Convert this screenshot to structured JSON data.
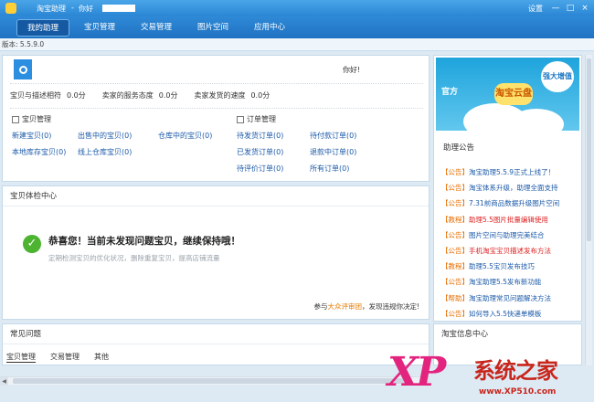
{
  "titlebar": {
    "app_title": "淘宝助理",
    "separator": "-",
    "user_label": "你好",
    "settings_label": "设置",
    "minimize": "—",
    "maximize": "□",
    "close": "×"
  },
  "nav": {
    "tabs": [
      {
        "label": "我的助理",
        "active": true
      },
      {
        "label": "宝贝管理",
        "active": false
      },
      {
        "label": "交易管理",
        "active": false
      },
      {
        "label": "图片空间",
        "active": false
      },
      {
        "label": "应用中心",
        "active": false
      }
    ]
  },
  "version": "版本: 5.5.9.0",
  "profile": {
    "username": "你好!",
    "ratings": [
      {
        "label": "宝贝与描述相符",
        "value": "0.0分"
      },
      {
        "label": "卖家的服务态度",
        "value": "0.0分"
      },
      {
        "label": "卖家发货的速度",
        "value": "0.0分"
      }
    ],
    "item_section": {
      "title": "宝贝管理",
      "links": [
        "出售中的宝贝(0)",
        "仓库中的宝贝(0)",
        "线上仓库宝贝(0)",
        "本地库存宝贝(0)",
        "新建宝贝(0)"
      ]
    },
    "order_section": {
      "title": "订单管理",
      "links": [
        "待发货订单(0)",
        "待付款订单(0)",
        "已发货订单(0)",
        "退款中订单(0)",
        "待评价订单(0)",
        "所有订单(0)"
      ]
    }
  },
  "health": {
    "title": "宝贝体检中心",
    "headline": "恭喜您！当前未发现问题宝贝，继续保持哦！",
    "subtext": "定期检测宝贝的优化状况，删除重复宝贝，提高店铺流量",
    "promo_prefix": "参与",
    "promo_highlight": "大众评审团",
    "promo_suffix": "，发现违规你决定!"
  },
  "faq": {
    "title": "常见问题",
    "tabs": [
      "宝贝管理",
      "交易管理",
      "其他"
    ]
  },
  "sidebar": {
    "banner": {
      "left_text": "官方",
      "center_text": "淘宝云盘",
      "badge_text": "强大增值"
    },
    "notice_title": "助理公告",
    "notices": [
      {
        "tag": "【公告】",
        "text": "淘宝助理5.5.9正式上线了！",
        "red": false
      },
      {
        "tag": "【公告】",
        "text": "淘宝体系升级，助理全面支持",
        "red": false
      },
      {
        "tag": "【公告】",
        "text": "7.31前商品数据升级图片空间",
        "red": false
      },
      {
        "tag": "【教程】",
        "text": "助理5.5图片批量编辑使用",
        "red": true
      },
      {
        "tag": "【公告】",
        "text": "图片空间与助理完美结合",
        "red": false
      },
      {
        "tag": "【公告】",
        "text": "手机淘宝宝贝描述发布方法",
        "red": true
      },
      {
        "tag": "【教程】",
        "text": "助理5.5宝贝发布技巧",
        "red": false
      },
      {
        "tag": "【公告】",
        "text": "淘宝助理5.5发布新功能",
        "red": false
      },
      {
        "tag": "【帮助】",
        "text": "淘宝助理常见问题解决方法",
        "red": false
      },
      {
        "tag": "【公告】",
        "text": "如何导入5.5快递单模板",
        "red": false
      }
    ],
    "bottom_title": "淘宝信息中心"
  },
  "watermark": {
    "xp": "XP",
    "brand": "系统之家",
    "url": "www.XP510.com"
  },
  "colors": {
    "accent": "#2a86d4",
    "link": "#1c5aa8",
    "notice_tag": "#e66e00",
    "check": "#4cb430"
  }
}
